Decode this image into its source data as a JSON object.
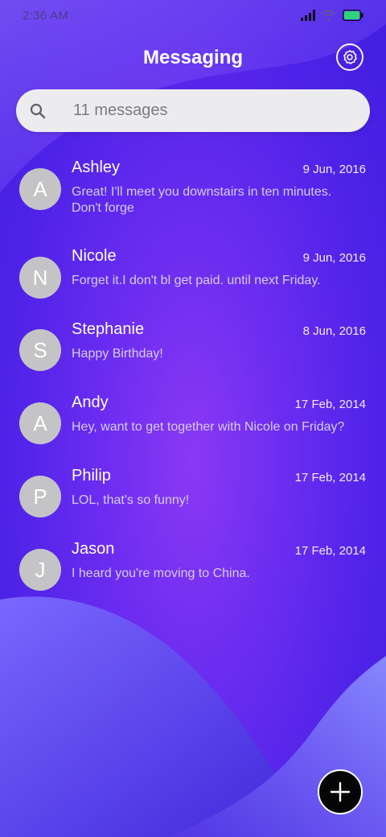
{
  "status_bar": {
    "time": "2:36 AM",
    "icons": [
      "signal-icon",
      "wifi-icon",
      "battery-icon"
    ],
    "battery_color": "#2ed47a"
  },
  "header": {
    "title": "Messaging",
    "settings_icon": "gear-icon"
  },
  "search": {
    "placeholder": "11 messages",
    "icon": "search-icon"
  },
  "conversations": [
    {
      "avatar": "A",
      "name": "Ashley",
      "date": "9 Jun, 2016",
      "preview": "Great! I'll meet you downstairs in ten minutes. Don't forge"
    },
    {
      "avatar": "N",
      "name": "Nicole",
      "date": "9 Jun, 2016",
      "preview": "Forget it.I don't bl get paid. until next Friday."
    },
    {
      "avatar": "S",
      "name": "Stephanie",
      "date": "8 Jun, 2016",
      "preview": "Happy Birthday!"
    },
    {
      "avatar": "A",
      "name": "Andy",
      "date": "17 Feb, 2014",
      "preview": "Hey, want to get together with Nicole on Friday?"
    },
    {
      "avatar": "P",
      "name": "Philip",
      "date": "17 Feb, 2014",
      "preview": "LOL, that's so funny!"
    },
    {
      "avatar": "J",
      "name": "Jason",
      "date": "17 Feb, 2014",
      "preview": "I heard you're moving to China."
    }
  ],
  "fab": {
    "icon": "plus-icon"
  },
  "colors": {
    "background_start": "#8b39f4",
    "background_end": "#3f1fe0",
    "avatar_gray": "#c4c4c6",
    "fab": "#050505"
  }
}
